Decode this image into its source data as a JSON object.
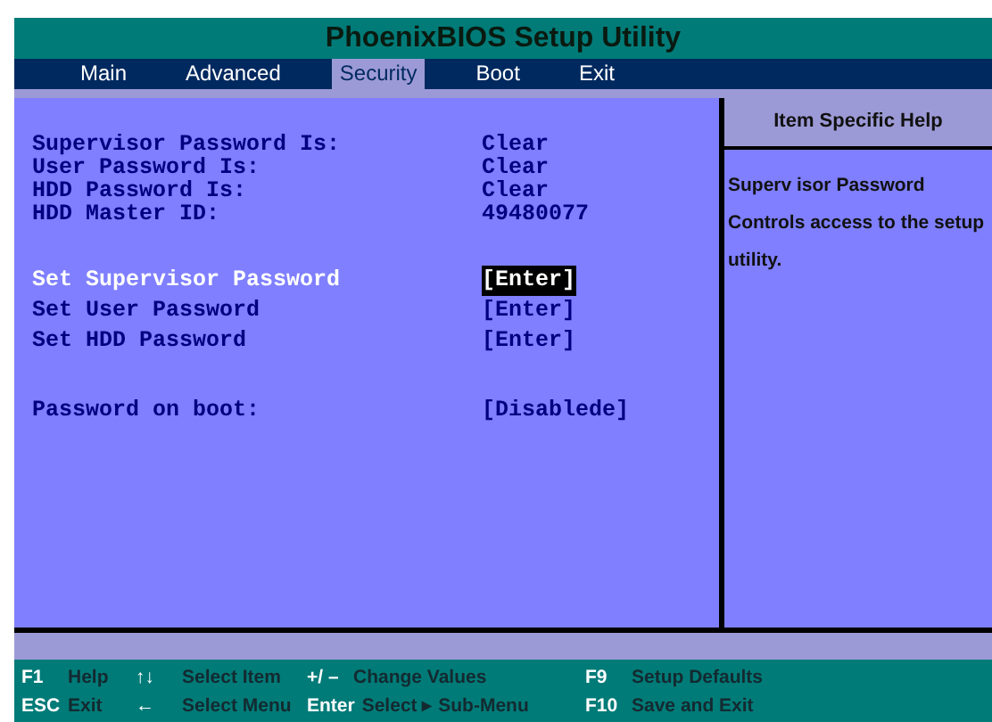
{
  "window": {
    "title": "PhoenixBIOS Setup Utility"
  },
  "menu": [
    {
      "label": "Main",
      "selected": false
    },
    {
      "label": "Advanced",
      "selected": false
    },
    {
      "label": "Security",
      "selected": true
    },
    {
      "label": "Boot",
      "selected": false
    },
    {
      "label": "Exit",
      "selected": false
    }
  ],
  "settings": [
    {
      "kind": "info",
      "label": "Supervisor Password Is:",
      "value": "Clear"
    },
    {
      "kind": "info",
      "label": "User Password Is:",
      "value": "Clear"
    },
    {
      "kind": "info",
      "label": "HDD Password Is:",
      "value": "Clear"
    },
    {
      "kind": "info",
      "label": "HDD Master ID:",
      "value": "49480077"
    },
    {
      "kind": "gap"
    },
    {
      "kind": "option",
      "label": "Set Supervisor Password",
      "value": "[Enter]",
      "selected": true
    },
    {
      "kind": "option",
      "label": "Set User Password",
      "value": "[Enter]",
      "selected": false
    },
    {
      "kind": "option",
      "label": "Set HDD Password",
      "value": "[Enter]",
      "selected": false
    },
    {
      "kind": "gap"
    },
    {
      "kind": "option",
      "label": "Password on boot:",
      "value": "[Disablede]",
      "selected": false
    }
  ],
  "help": {
    "title": "Item Specific Help",
    "text": "Superv isor Password Controls access to the setup utility."
  },
  "footer": [
    {
      "key": "F1",
      "action": "Help"
    },
    {
      "key": "ESC",
      "action": "Exit"
    },
    {
      "key": "↑↓",
      "action": "Select Item"
    },
    {
      "key": "←",
      "action": "Select Menu"
    },
    {
      "key": "+/ –",
      "action": "Change Values"
    },
    {
      "key": "Enter",
      "action": "Select ▸ Sub-Menu"
    },
    {
      "key": "F9",
      "action": "Setup Defaults"
    },
    {
      "key": "F10",
      "action": "Save and Exit"
    }
  ]
}
